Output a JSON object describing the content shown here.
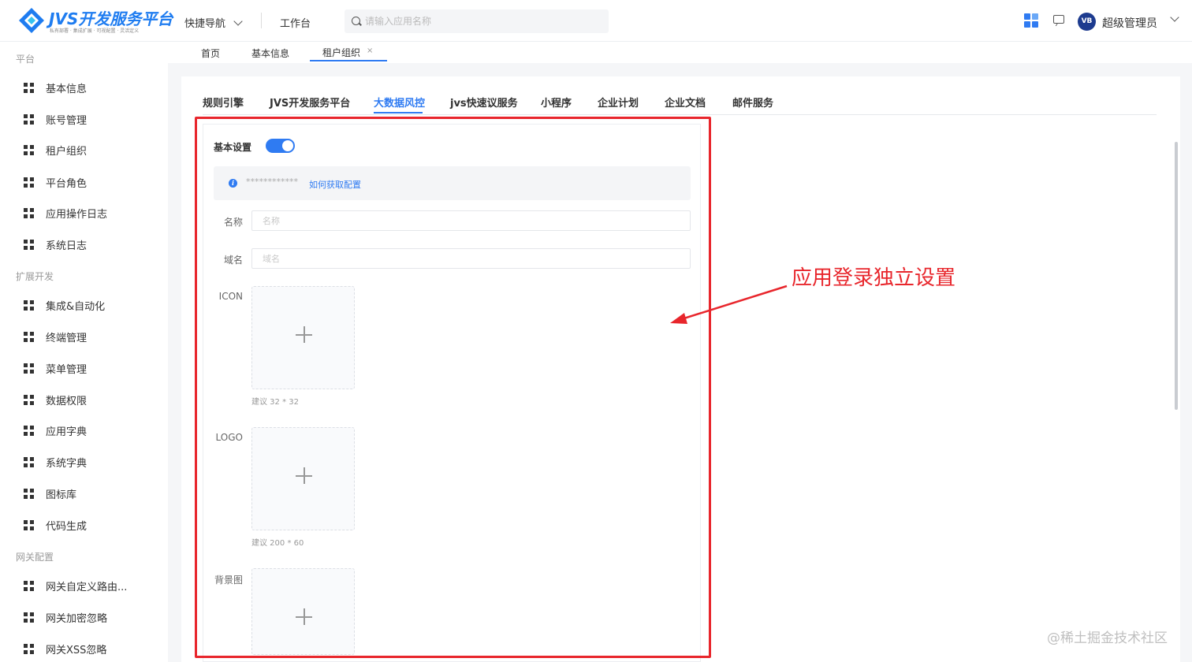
{
  "brand": {
    "title": "JVS开发服务平台",
    "subtitle": "私有部署 · 集成扩展 · 可视配置 · 灵活定义"
  },
  "header": {
    "quick_nav": "快捷导航",
    "workbench": "工作台",
    "search_placeholder": "请输入应用名称",
    "avatar_text": "VB",
    "user_name": "超级管理员"
  },
  "sidebar": {
    "groups": [
      {
        "label": "平台",
        "items": [
          "基本信息",
          "账号管理",
          "租户组织",
          "平台角色",
          "应用操作日志",
          "系统日志"
        ]
      },
      {
        "label": "扩展开发",
        "items": [
          "集成&自动化",
          "终端管理",
          "菜单管理",
          "数据权限",
          "应用字典",
          "系统字典",
          "图标库",
          "代码生成"
        ]
      },
      {
        "label": "网关配置",
        "items": [
          "网关自定义路由...",
          "网关加密忽略",
          "网关XSS忽略"
        ]
      }
    ]
  },
  "page_tabs": {
    "items": [
      "首页",
      "基本信息",
      "租户组织"
    ],
    "active": "租户组织",
    "close_symbol": "×"
  },
  "service_tabs": {
    "items": [
      "规则引擎",
      "JVS开发服务平台",
      "大数据风控",
      "jvs快速议服务",
      "小程序",
      "企业计划",
      "企业文档",
      "邮件服务"
    ],
    "active": "大数据风控"
  },
  "settings": {
    "basic_label": "基本设置",
    "enabled": true,
    "info_mask": "************",
    "info_link": "如何获取配置",
    "name_label": "名称",
    "name_placeholder": "名称",
    "domain_label": "域名",
    "domain_placeholder": "域名",
    "icon_label": "ICON",
    "icon_hint": "建议 32 * 32",
    "logo_label": "LOGO",
    "logo_hint": "建议 200 * 60",
    "bg_label": "背景图"
  },
  "annotation": {
    "text": "应用登录独立设置",
    "color": "#e8262c"
  },
  "watermark": "@稀土掘金技术社区",
  "colors": {
    "accent": "#2f7bf2",
    "annotation": "#e8262c"
  }
}
